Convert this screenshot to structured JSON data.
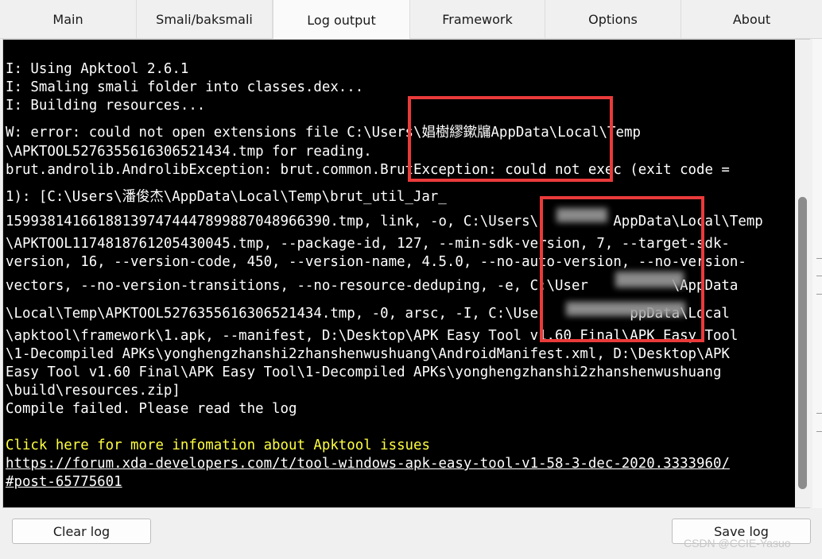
{
  "tabs": [
    {
      "label": "Main",
      "active": false
    },
    {
      "label": "Smali/baksmali",
      "active": false
    },
    {
      "label": "Log output",
      "active": true
    },
    {
      "label": "Framework",
      "active": false
    },
    {
      "label": "Options",
      "active": false
    },
    {
      "label": "About",
      "active": false
    }
  ],
  "log": {
    "lines": [
      "I: Using Apktool 2.6.1",
      "I: Smaling smali folder into classes.dex...",
      "I: Building resources...",
      "W: error: could not open extensions file C:\\Users\\娼樹繆鏉牖AppData\\Local\\Temp",
      "\\APKTOOL5276355616306521434.tmp for reading.",
      "brut.androlib.AndrolibException: brut.common.BrutException: could not exec (exit code =",
      "1): [C:\\Users\\潘俊杰\\AppData\\Local\\Temp\\brut_util_Jar_",
      "1599381416618813974744478998870489663​90.tmp, link, -o, C:\\Users\\         AppData\\Local\\Temp",
      "\\APKTOOL1174818761205430045.tmp, --package-id, 127, --min-sdk-version, 7, --target-sdk-",
      "version, 16, --version-code, 450, --version-name, 4.5.0, --no-auto-version, --no-version-",
      "vectors, --no-version-transitions, --no-resource-deduping, -e, C:\\User          \\AppData",
      "\\Local\\Temp\\APKTOOL5276355616306521434.tmp, -0, arsc, -I, C:\\Use           ppData\\Local",
      "\\apktool\\framework\\1.apk, --manifest, D:\\Desktop\\APK Easy Tool v1.60 Final\\APK Easy Tool",
      "\\1-Decompiled APKs\\yonghengzhanshi2zhanshenwushuang\\AndroidManifest.xml, D:\\Desktop\\APK",
      "Easy Tool v1.60 Final\\APK Easy Tool\\1-Decompiled APKs\\yonghengzhanshi2zhanshenwushuang",
      "\\build\\resources.zip]",
      "Compile failed. Please read the log"
    ],
    "info_link_text": "Click here for more infomation about Apktool issues",
    "url_line1": "https://forum.xda-developers.com/t/tool-windows-apk-easy-tool-v1-58-3-dec-2020.3333960/",
    "url_line2": "#post-65775601"
  },
  "buttons": {
    "clear": "Clear log",
    "save": "Save log"
  },
  "watermark": "CSDN @CCIE-Yasuo",
  "colors": {
    "log_background": "#000000",
    "log_text": "#ffffff",
    "info_link": "#ffff40",
    "annotation_box": "#ea3a3a"
  }
}
